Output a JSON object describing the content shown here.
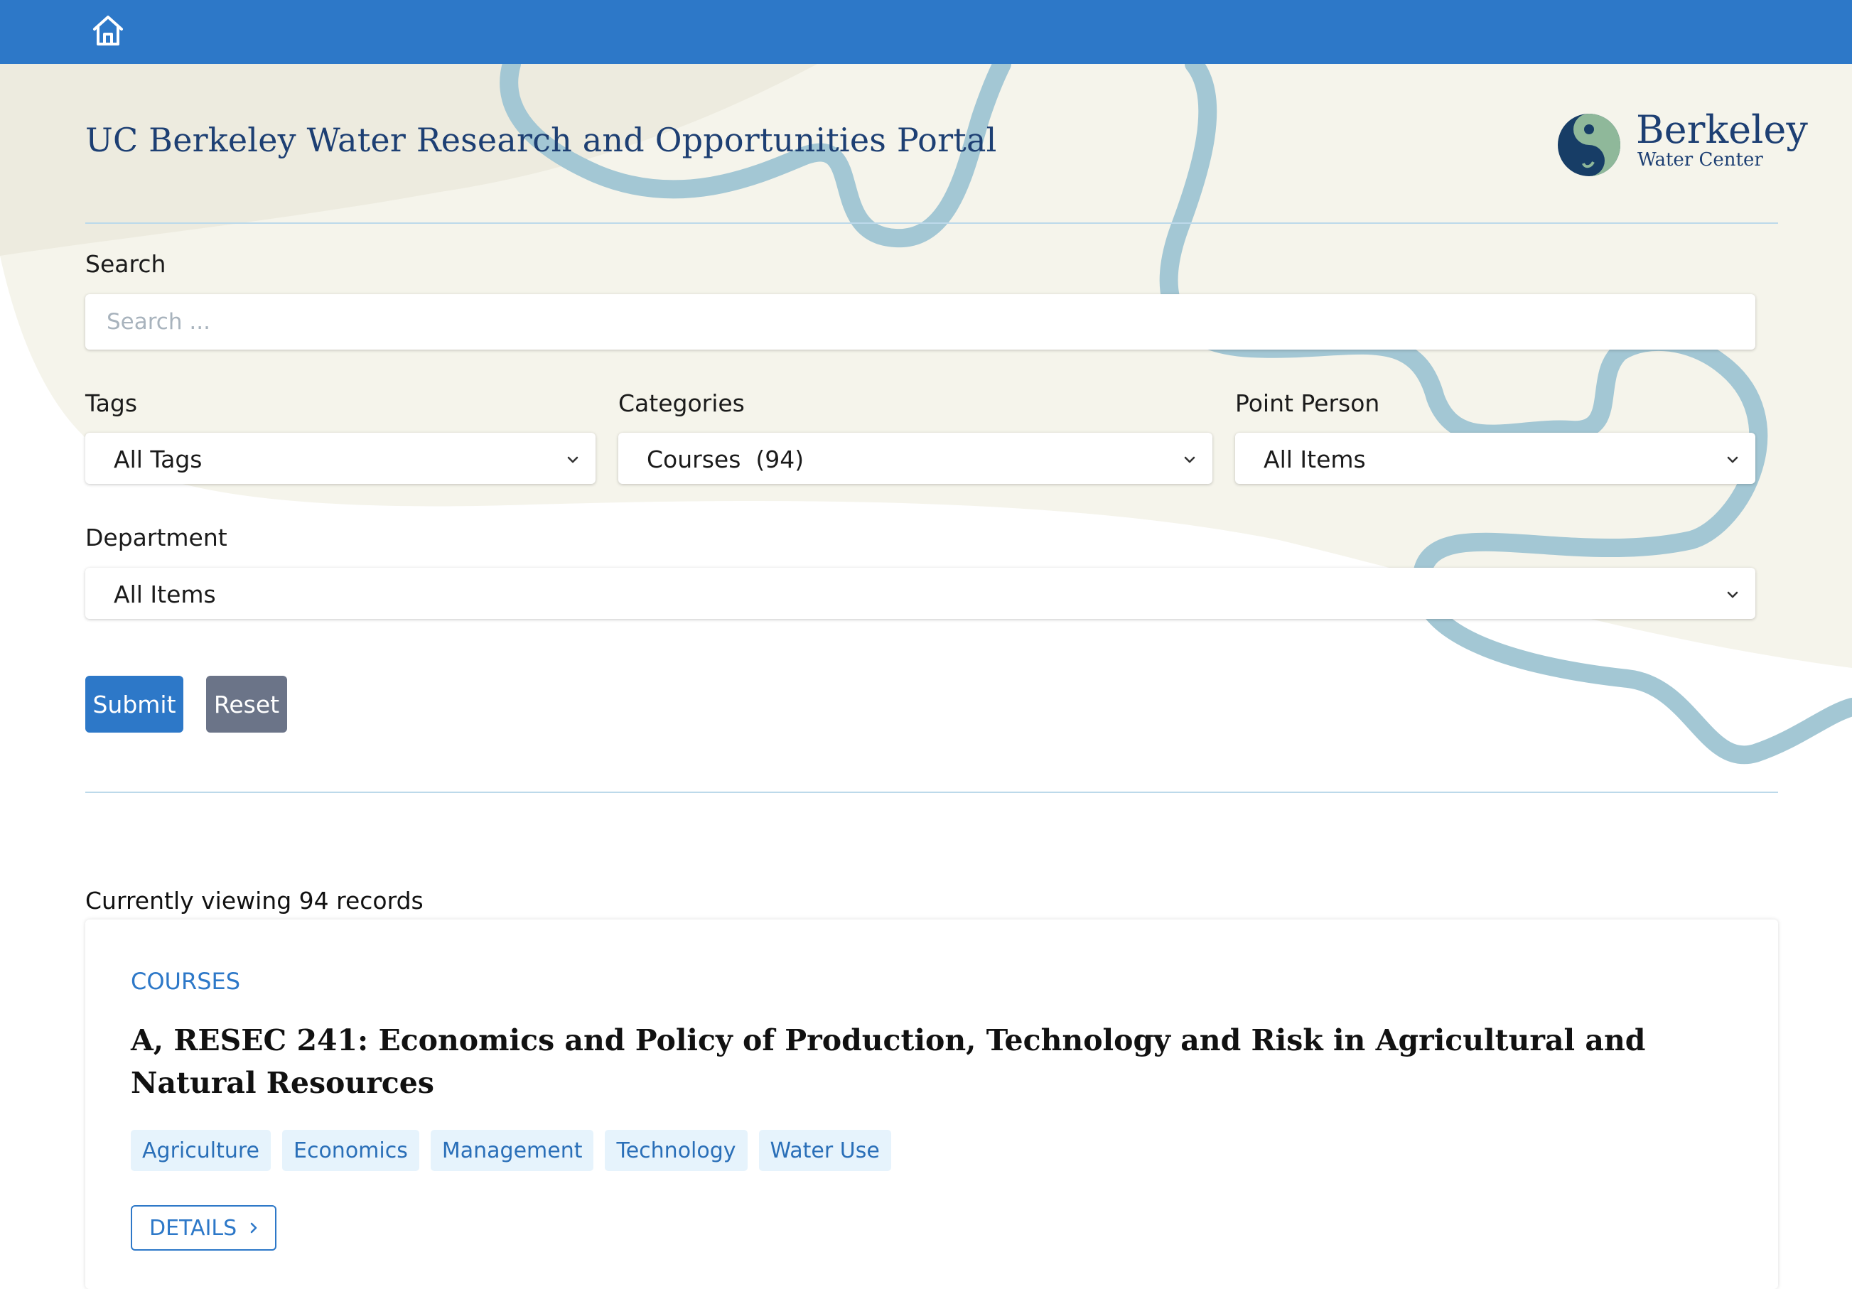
{
  "header": {
    "home_icon": "home-icon",
    "bar_color": "#2d78c8"
  },
  "page": {
    "title": "UC Berkeley Water Research and Opportunities Portal",
    "logo": {
      "name": "Berkeley",
      "subtitle": "Water Center"
    }
  },
  "filters": {
    "search": {
      "label": "Search",
      "placeholder": "Search ...",
      "value": ""
    },
    "tags": {
      "label": "Tags",
      "selected": "All Tags"
    },
    "categories": {
      "label": "Categories",
      "selected": "Courses  (94)"
    },
    "point_person": {
      "label": "Point Person",
      "selected": "All Items"
    },
    "department": {
      "label": "Department",
      "selected": "All Items"
    },
    "submit_label": "Submit",
    "reset_label": "Reset"
  },
  "results": {
    "summary": "Currently viewing 94 records",
    "items": [
      {
        "category": "COURSES",
        "title": "A, RESEC 241: Economics and Policy of Production, Technology and Risk in Agricultural and Natural Resources",
        "tags": [
          "Agriculture",
          "Economics",
          "Management",
          "Technology",
          "Water Use"
        ],
        "details_label": "DETAILS"
      }
    ]
  },
  "colors": {
    "accent": "#2d78c8",
    "reset_button": "#6b7488",
    "title_text": "#1d3f73",
    "tag_bg": "#e6f3fc",
    "river": "#a3c7d4",
    "background_shape": "#f4f3e9"
  }
}
